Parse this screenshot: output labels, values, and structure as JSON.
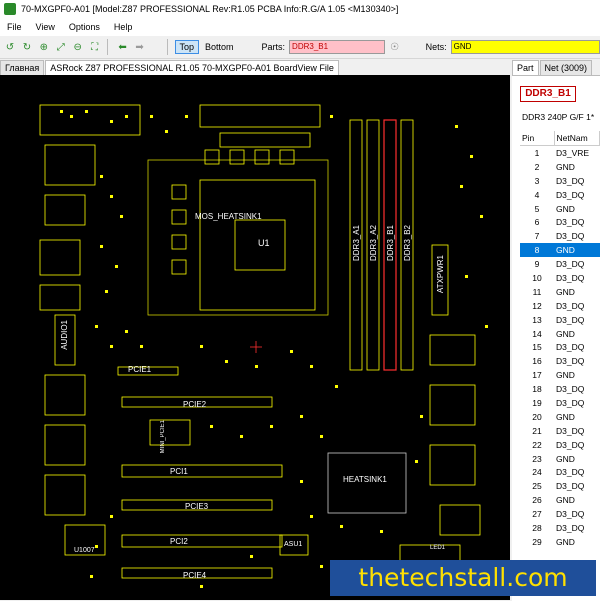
{
  "window": {
    "title": "70-MXGPF0-A01 [Model:Z87 PROFESSIONAL Rev:R1.05 PCBA Info:R.G/A 1.05   <M130340>]"
  },
  "menu": [
    "File",
    "View",
    "Options",
    "Help"
  ],
  "toolbar": {
    "top_label": "Top",
    "bottom_label": "Bottom",
    "parts_label": "Parts:",
    "parts_value": "DDR3_B1",
    "nets_label": "Nets:",
    "nets_value": "GND"
  },
  "tabs": {
    "home": "Главная",
    "board": "ASRock Z87 PROFESSIONAL R1.05 70-MXGPF0-A01 BoardView File"
  },
  "panel": {
    "tab_part": "Part",
    "tab_net": "Net (3009)",
    "part_name": "DDR3_B1",
    "part_desc": "DDR3 240P G/F 1*",
    "col_pin": "Pin",
    "col_net": "NetNam",
    "rows": [
      {
        "pin": "1",
        "net": "D3_VRE"
      },
      {
        "pin": "2",
        "net": "GND"
      },
      {
        "pin": "3",
        "net": "D3_DQ"
      },
      {
        "pin": "4",
        "net": "D3_DQ"
      },
      {
        "pin": "5",
        "net": "GND"
      },
      {
        "pin": "6",
        "net": "D3_DQ"
      },
      {
        "pin": "7",
        "net": "D3_DQ"
      },
      {
        "pin": "8",
        "net": "GND"
      },
      {
        "pin": "9",
        "net": "D3_DQ"
      },
      {
        "pin": "10",
        "net": "D3_DQ"
      },
      {
        "pin": "11",
        "net": "GND"
      },
      {
        "pin": "12",
        "net": "D3_DQ"
      },
      {
        "pin": "13",
        "net": "D3_DQ"
      },
      {
        "pin": "14",
        "net": "GND"
      },
      {
        "pin": "15",
        "net": "D3_DQ"
      },
      {
        "pin": "16",
        "net": "D3_DQ"
      },
      {
        "pin": "17",
        "net": "GND"
      },
      {
        "pin": "18",
        "net": "D3_DQ"
      },
      {
        "pin": "19",
        "net": "D3_DQ"
      },
      {
        "pin": "20",
        "net": "GND"
      },
      {
        "pin": "21",
        "net": "D3_DQ"
      },
      {
        "pin": "22",
        "net": "D3_DQ"
      },
      {
        "pin": "23",
        "net": "GND"
      },
      {
        "pin": "24",
        "net": "D3_DQ"
      },
      {
        "pin": "25",
        "net": "D3_DQ"
      },
      {
        "pin": "26",
        "net": "GND"
      },
      {
        "pin": "27",
        "net": "D3_DQ"
      },
      {
        "pin": "28",
        "net": "D3_DQ"
      },
      {
        "pin": "29",
        "net": "GND"
      }
    ],
    "selected_pin": "8"
  },
  "board_labels": {
    "mos": "MOS_HEATSINK1",
    "u1": "U1",
    "ddr_a1": "DDR3_A1",
    "ddr_a2": "DDR3_A2",
    "ddr_b1": "DDR3_B1",
    "ddr_b2": "DDR3_B2",
    "atx": "ATXPWR1",
    "audio": "AUDIO1",
    "pcie1": "PCIE1",
    "pcie2": "PCIE2",
    "mini_pcie": "MINI_PCIE1",
    "pci1": "PCI1",
    "pcie3": "PCIE3",
    "pci2": "PCI2",
    "pcie4": "PCIE4",
    "heatsink": "HEATSINK1",
    "asu1": "ASU1",
    "u1007": "U1007",
    "led1": "LED1"
  },
  "watermark": "thetechstall.com",
  "colors": {
    "silkscreen": "#ffff00",
    "selected_part": "#ff3030",
    "canvas": "#000000",
    "selection": "#0078d7"
  }
}
